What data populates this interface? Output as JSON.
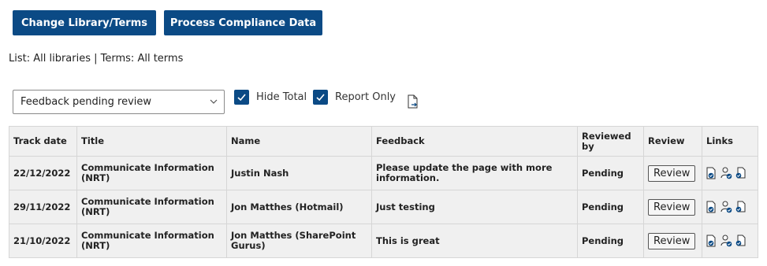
{
  "toolbar": {
    "change_library_label": "Change Library/Terms",
    "process_compliance_label": "Process Compliance Data"
  },
  "filter_summary": "List: All libraries | Terms: All terms",
  "status_filter": {
    "selected": "Feedback pending review"
  },
  "options": {
    "hide_total": {
      "label": "Hide Total",
      "checked": true
    },
    "report_only": {
      "label": "Report Only",
      "checked": true
    }
  },
  "icons": {
    "export": "export-document-icon",
    "link_icons": [
      "user-document-icon",
      "user-approve-icon",
      "users-document-icon"
    ]
  },
  "colors": {
    "accent": "#0b4a85",
    "table_bg": "#f0f0f0"
  },
  "table": {
    "headers": {
      "track_date": "Track date",
      "title": "Title",
      "name": "Name",
      "feedback": "Feedback",
      "reviewed_by": "Reviewed by",
      "review": "Review",
      "links": "Links"
    },
    "rows": [
      {
        "track_date": "22/12/2022",
        "title": "Communicate Information (NRT)",
        "name": "Justin Nash",
        "feedback": "Please update the page with more information.",
        "reviewed_by": "Pending",
        "review_label": "Review"
      },
      {
        "track_date": "29/11/2022",
        "title": "Communicate Information (NRT)",
        "name": "Jon Matthes (Hotmail)",
        "feedback": "Just testing",
        "reviewed_by": "Pending",
        "review_label": "Review"
      },
      {
        "track_date": "21/10/2022",
        "title": "Communicate Information (NRT)",
        "name": "Jon Matthes (SharePoint Gurus)",
        "feedback": "This is great",
        "reviewed_by": "Pending",
        "review_label": "Review"
      }
    ]
  }
}
